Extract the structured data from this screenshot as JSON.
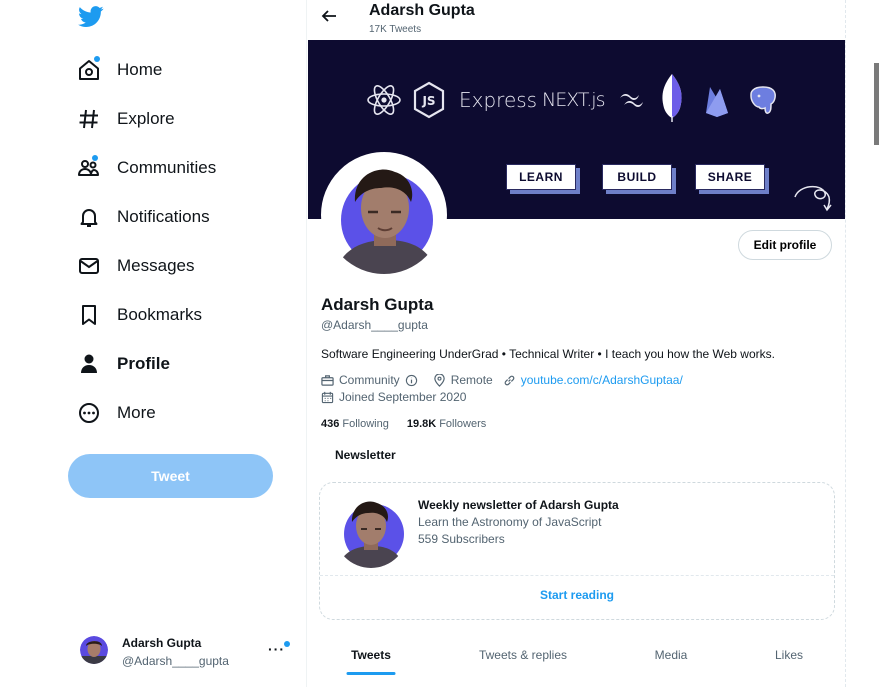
{
  "sidebar": {
    "items": [
      {
        "label": "Home",
        "icon": "home-icon"
      },
      {
        "label": "Explore",
        "icon": "hashtag-icon"
      },
      {
        "label": "Communities",
        "icon": "communities-icon"
      },
      {
        "label": "Notifications",
        "icon": "bell-icon"
      },
      {
        "label": "Messages",
        "icon": "envelope-icon"
      },
      {
        "label": "Bookmarks",
        "icon": "bookmark-icon"
      },
      {
        "label": "Profile",
        "icon": "person-icon"
      },
      {
        "label": "More",
        "icon": "more-circle-icon"
      }
    ],
    "tweet_button": "Tweet",
    "account": {
      "name": "Adarsh Gupta",
      "handle": "@Adarsh____gupta",
      "more": "···"
    }
  },
  "header": {
    "name": "Adarsh Gupta",
    "tweet_count": "17K Tweets"
  },
  "banner": {
    "tech_labels": [
      "Express",
      "NEXT.js"
    ],
    "chips": [
      "LEARN",
      "BUILD",
      "SHARE"
    ]
  },
  "profile": {
    "edit_button": "Edit profile",
    "display_name": "Adarsh Gupta",
    "handle": "@Adarsh____gupta",
    "bio": "Software Engineering UnderGrad • Technical Writer • I teach you how the Web works.",
    "category": "Community",
    "location": "Remote",
    "website": "youtube.com/c/AdarshGuptaa/",
    "joined": "Joined September 2020",
    "following_count": "436",
    "following_label": "Following",
    "followers_count": "19.8K",
    "followers_label": "Followers"
  },
  "newsletter": {
    "section_label": "Newsletter",
    "title": "Weekly newsletter of Adarsh Gupta",
    "subtitle": "Learn the Astronomy of JavaScript",
    "subscribers": "559 Subscribers",
    "cta": "Start reading"
  },
  "tabs": [
    "Tweets",
    "Tweets & replies",
    "Media",
    "Likes"
  ],
  "colors": {
    "accent": "#1d9bf0",
    "tweet_button": "#8ec5f7",
    "banner_bg": "#0d0b30",
    "text_primary": "#0f1419",
    "text_secondary": "#536471"
  }
}
